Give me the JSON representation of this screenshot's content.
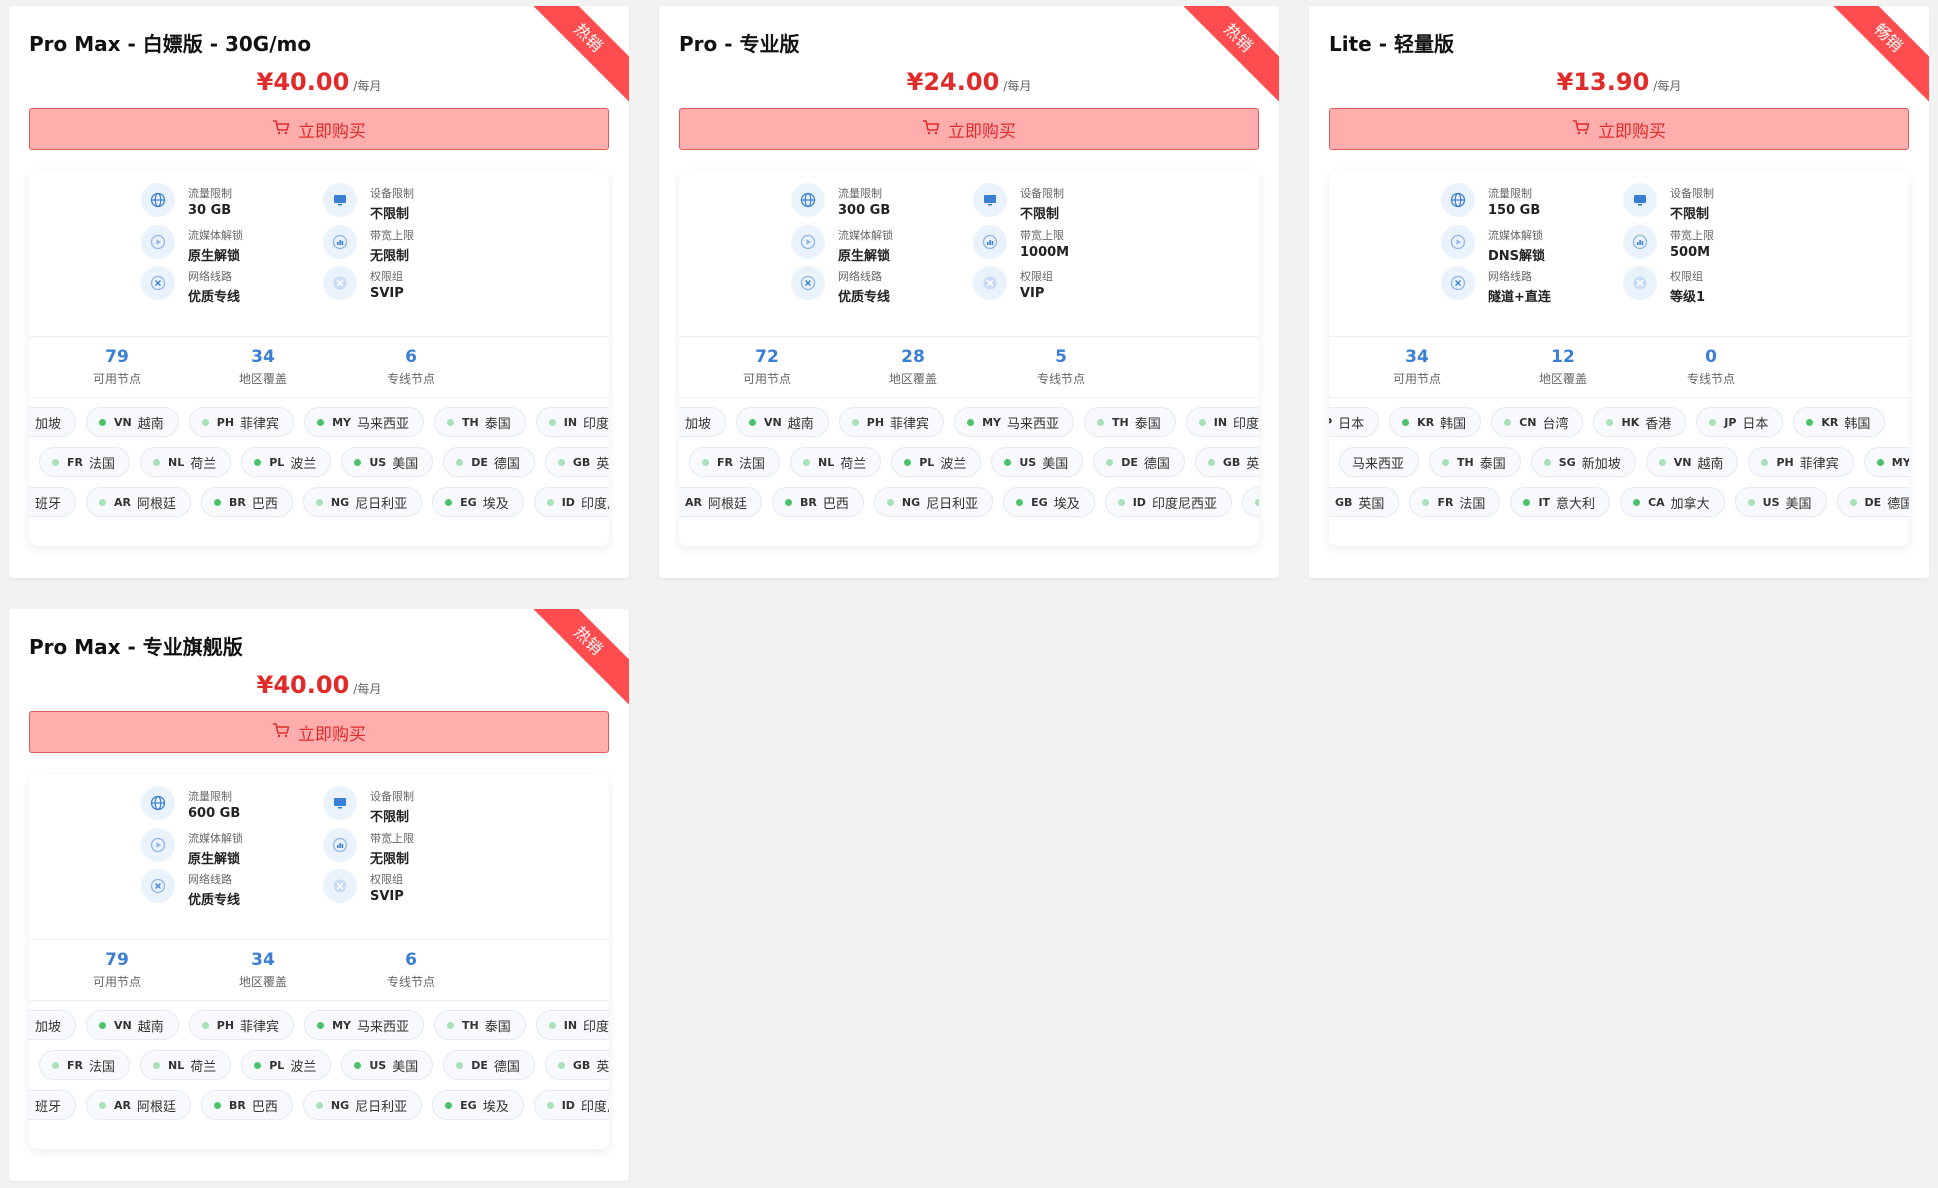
{
  "colors": {
    "accent": "#3b7fd4",
    "price": "#e02b2b",
    "ribbon": "#ff4d4f",
    "dot_strong": "#4cc36b",
    "dot_light": "#a9e2b8"
  },
  "labels": {
    "buy": "立即购买",
    "traffic": "流量限制",
    "devices": "设备限制",
    "streaming": "流媒体解锁",
    "bandwidth": "带宽上限",
    "route": "网络线路",
    "group": "权限组",
    "nodes": "可用节点",
    "regions": "地区覆盖",
    "dedicated": "专线节点"
  },
  "plans": [
    {
      "title": "Pro Max - 白嫖版 - 30G/mo",
      "badge": "热销",
      "price": "¥40.00",
      "period": "/每月",
      "traffic": "30 GB",
      "devices": "不限制",
      "streaming": "原生解锁",
      "bandwidth": "无限制",
      "route": "优质专线",
      "group": "SVIP",
      "nodes": "79",
      "regions": "34",
      "dedicated": "6",
      "chip_rows": [
        [
          {
            "cc": "",
            "name": "加坡",
            "dot": "light"
          },
          {
            "cc": "VN",
            "name": "越南",
            "dot": "strong"
          },
          {
            "cc": "PH",
            "name": "菲律宾",
            "dot": "light"
          },
          {
            "cc": "MY",
            "name": "马来西亚",
            "dot": "strong"
          },
          {
            "cc": "TH",
            "name": "泰国",
            "dot": "light"
          },
          {
            "cc": "IN",
            "name": "印度",
            "dot": "light"
          }
        ],
        [
          {
            "cc": "FR",
            "name": "法国",
            "dot": "light"
          },
          {
            "cc": "NL",
            "name": "荷兰",
            "dot": "light"
          },
          {
            "cc": "PL",
            "name": "波兰",
            "dot": "strong"
          },
          {
            "cc": "US",
            "name": "美国",
            "dot": "strong"
          },
          {
            "cc": "DE",
            "name": "德国",
            "dot": "light"
          },
          {
            "cc": "GB",
            "name": "英国",
            "dot": "light"
          }
        ],
        [
          {
            "cc": "",
            "name": "班牙",
            "dot": "light"
          },
          {
            "cc": "AR",
            "name": "阿根廷",
            "dot": "light"
          },
          {
            "cc": "BR",
            "name": "巴西",
            "dot": "strong"
          },
          {
            "cc": "NG",
            "name": "尼日利亚",
            "dot": "light"
          },
          {
            "cc": "EG",
            "name": "埃及",
            "dot": "strong"
          },
          {
            "cc": "ID",
            "name": "印度尼西亚",
            "dot": "light"
          }
        ]
      ]
    },
    {
      "title": "Pro - 专业版",
      "badge": "热销",
      "price": "¥24.00",
      "period": "/每月",
      "traffic": "300 GB",
      "devices": "不限制",
      "streaming": "原生解锁",
      "bandwidth": "1000M",
      "route": "优质专线",
      "group": "VIP",
      "nodes": "72",
      "regions": "28",
      "dedicated": "5",
      "chip_rows": [
        [
          {
            "cc": "",
            "name": "加坡",
            "dot": "light"
          },
          {
            "cc": "VN",
            "name": "越南",
            "dot": "strong"
          },
          {
            "cc": "PH",
            "name": "菲律宾",
            "dot": "light"
          },
          {
            "cc": "MY",
            "name": "马来西亚",
            "dot": "strong"
          },
          {
            "cc": "TH",
            "name": "泰国",
            "dot": "light"
          },
          {
            "cc": "IN",
            "name": "印度",
            "dot": "light"
          }
        ],
        [
          {
            "cc": "FR",
            "name": "法国",
            "dot": "light"
          },
          {
            "cc": "NL",
            "name": "荷兰",
            "dot": "light"
          },
          {
            "cc": "PL",
            "name": "波兰",
            "dot": "strong"
          },
          {
            "cc": "US",
            "name": "美国",
            "dot": "strong"
          },
          {
            "cc": "DE",
            "name": "德国",
            "dot": "light"
          },
          {
            "cc": "GB",
            "name": "英国",
            "dot": "light"
          }
        ],
        [
          {
            "cc": "AR",
            "name": "阿根廷",
            "dot": "light"
          },
          {
            "cc": "BR",
            "name": "巴西",
            "dot": "strong"
          },
          {
            "cc": "NG",
            "name": "尼日利亚",
            "dot": "light"
          },
          {
            "cc": "EG",
            "name": "埃及",
            "dot": "strong"
          },
          {
            "cc": "ID",
            "name": "印度尼西亚",
            "dot": "light"
          },
          {
            "cc": "P",
            "name": "",
            "dot": "light"
          }
        ]
      ]
    },
    {
      "title": "Lite - 轻量版",
      "badge": "畅销",
      "price": "¥13.90",
      "period": "/每月",
      "traffic": "150 GB",
      "devices": "不限制",
      "streaming": "DNS解锁",
      "bandwidth": "500M",
      "route": "隧道+直连",
      "group": "等级1",
      "nodes": "34",
      "regions": "12",
      "dedicated": "0",
      "chip_rows": [
        [
          {
            "cc": "JP",
            "name": "日本",
            "dot": "none"
          },
          {
            "cc": "KR",
            "name": "韩国",
            "dot": "strong"
          },
          {
            "cc": "CN",
            "name": "台湾",
            "dot": "light"
          },
          {
            "cc": "HK",
            "name": "香港",
            "dot": "light"
          },
          {
            "cc": "JP",
            "name": "日本",
            "dot": "light"
          },
          {
            "cc": "KR",
            "name": "韩国",
            "dot": "strong"
          }
        ],
        [
          {
            "cc": "",
            "name": "马来西亚",
            "dot": "none"
          },
          {
            "cc": "TH",
            "name": "泰国",
            "dot": "light"
          },
          {
            "cc": "SG",
            "name": "新加坡",
            "dot": "light"
          },
          {
            "cc": "VN",
            "name": "越南",
            "dot": "light"
          },
          {
            "cc": "PH",
            "name": "菲律宾",
            "dot": "light"
          },
          {
            "cc": "MY",
            "name": "马来西",
            "dot": "strong"
          }
        ],
        [
          {
            "cc": "GB",
            "name": "英国",
            "dot": "light"
          },
          {
            "cc": "FR",
            "name": "法国",
            "dot": "light"
          },
          {
            "cc": "IT",
            "name": "意大利",
            "dot": "strong"
          },
          {
            "cc": "CA",
            "name": "加拿大",
            "dot": "strong"
          },
          {
            "cc": "US",
            "name": "美国",
            "dot": "light"
          },
          {
            "cc": "DE",
            "name": "德国",
            "dot": "light"
          }
        ]
      ]
    },
    {
      "title": "Pro Max - 专业旗舰版",
      "badge": "热销",
      "price": "¥40.00",
      "period": "/每月",
      "traffic": "600 GB",
      "devices": "不限制",
      "streaming": "原生解锁",
      "bandwidth": "无限制",
      "route": "优质专线",
      "group": "SVIP",
      "nodes": "79",
      "regions": "34",
      "dedicated": "6",
      "chip_rows": [
        [
          {
            "cc": "",
            "name": "加坡",
            "dot": "light"
          },
          {
            "cc": "VN",
            "name": "越南",
            "dot": "strong"
          },
          {
            "cc": "PH",
            "name": "菲律宾",
            "dot": "light"
          },
          {
            "cc": "MY",
            "name": "马来西亚",
            "dot": "strong"
          },
          {
            "cc": "TH",
            "name": "泰国",
            "dot": "light"
          },
          {
            "cc": "IN",
            "name": "印度",
            "dot": "light"
          }
        ],
        [
          {
            "cc": "FR",
            "name": "法国",
            "dot": "light"
          },
          {
            "cc": "NL",
            "name": "荷兰",
            "dot": "light"
          },
          {
            "cc": "PL",
            "name": "波兰",
            "dot": "strong"
          },
          {
            "cc": "US",
            "name": "美国",
            "dot": "strong"
          },
          {
            "cc": "DE",
            "name": "德国",
            "dot": "light"
          },
          {
            "cc": "GB",
            "name": "英国",
            "dot": "light"
          }
        ],
        [
          {
            "cc": "",
            "name": "班牙",
            "dot": "light"
          },
          {
            "cc": "AR",
            "name": "阿根廷",
            "dot": "light"
          },
          {
            "cc": "BR",
            "name": "巴西",
            "dot": "strong"
          },
          {
            "cc": "NG",
            "name": "尼日利亚",
            "dot": "light"
          },
          {
            "cc": "EG",
            "name": "埃及",
            "dot": "strong"
          },
          {
            "cc": "ID",
            "name": "印度尼西亚",
            "dot": "light"
          }
        ]
      ]
    }
  ]
}
